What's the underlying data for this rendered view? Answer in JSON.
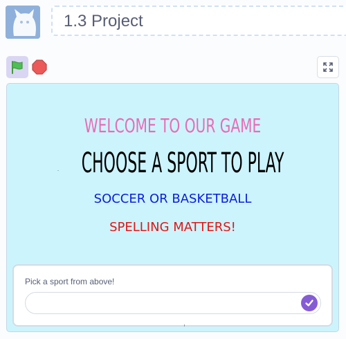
{
  "header": {
    "project_title": "1.3 Project",
    "thumbnail_icon": "scratch-cat-icon"
  },
  "controls": {
    "green_flag_icon": "green-flag-icon",
    "stop_icon": "stop-sign-icon",
    "fullscreen_icon": "fullscreen-icon"
  },
  "stage": {
    "line1": "WELCOME TO OUR GAME",
    "line2": "CHOOSE A SPORT TO PLAY",
    "line3": "SOCCER OR BASKETBALL",
    "line4": "SPELLING MATTERS!",
    "background_color": "#ccf4fd",
    "line1_color": "#ea6bb5",
    "line2_color": "#000000",
    "line3_color": "#0a1ddc",
    "line4_color": "#e01616"
  },
  "ask": {
    "question": "Pick a sport from above!",
    "input_value": "",
    "submit_icon": "check-icon",
    "accent_color": "#855cd6"
  }
}
